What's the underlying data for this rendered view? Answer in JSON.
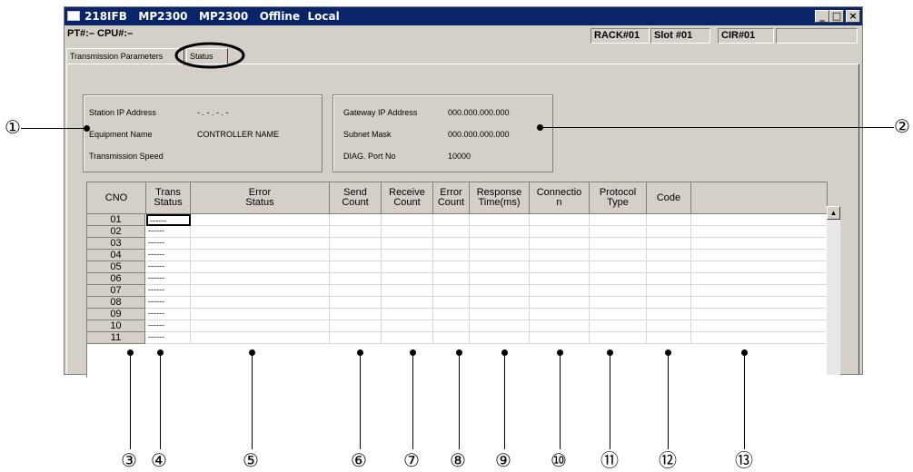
{
  "window": {
    "title": "218IFB   MP2300   MP2300   Offline  Local",
    "min_btn": "_",
    "max_btn": "□",
    "close_btn": "×"
  },
  "status_bar": {
    "pt_cpu": "PT#:– CPU#:–",
    "rack": "RACK#01",
    "slot": "Slot #01",
    "cir": "CIR#01"
  },
  "tabs": [
    {
      "label": "Transmission Parameters"
    },
    {
      "label": "Status"
    }
  ],
  "group_left": {
    "station_ip_label": "Station IP Address",
    "station_ip_value": "- . - . - . -",
    "equipment_name_label": "Equipment  Name",
    "equipment_name_value": "CONTROLLER NAME",
    "transmission_speed_label": "Transmission Speed"
  },
  "group_right": {
    "gateway_label": "Gateway IP Address",
    "gateway_value": "000.000.000.000",
    "subnet_label": "Subnet Mask",
    "subnet_value": "000.000.000.000",
    "diag_label": "DIAG. Port No",
    "diag_value": "10000"
  },
  "table": {
    "headers": [
      "CNO",
      "Trans\nStatus",
      "Error\nStatus",
      "Send\nCount",
      "Receive\nCount",
      "Error\nCount",
      "Response\nTime(ms)",
      "Connectio\nn",
      "Protocol\nType",
      "Code",
      ""
    ],
    "rows": [
      {
        "cno": "01",
        "trans": "------"
      },
      {
        "cno": "02",
        "trans": "------"
      },
      {
        "cno": "03",
        "trans": "------"
      },
      {
        "cno": "04",
        "trans": "------"
      },
      {
        "cno": "05",
        "trans": "------"
      },
      {
        "cno": "06",
        "trans": "------"
      },
      {
        "cno": "07",
        "trans": "------"
      },
      {
        "cno": "08",
        "trans": "------"
      },
      {
        "cno": "09",
        "trans": "------"
      },
      {
        "cno": "10",
        "trans": "------"
      },
      {
        "cno": "11",
        "trans": "------"
      }
    ],
    "scroll_up": "▲"
  },
  "callouts": [
    "①",
    "②",
    "③",
    "④",
    "⑤",
    "⑥",
    "⑦",
    "⑧",
    "⑨",
    "⑩",
    "⑪",
    "⑫",
    "⑬"
  ]
}
